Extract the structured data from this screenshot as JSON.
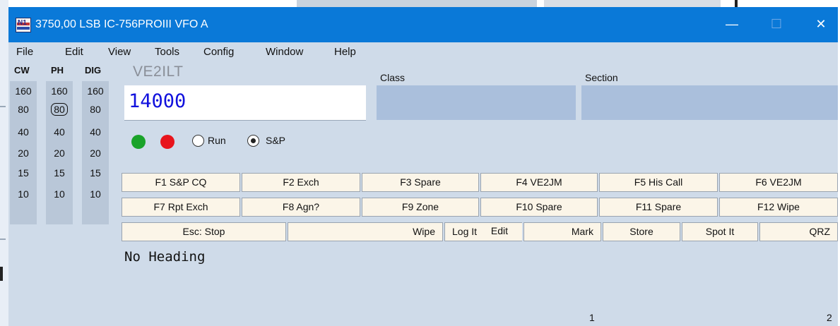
{
  "window": {
    "title": "3750,00 LSB IC-756PROIII VFO A"
  },
  "window_controls": {
    "minimize": "—",
    "maximize": "☐",
    "close": "✕"
  },
  "menu": [
    "File",
    "Edit",
    "View",
    "Tools",
    "Config",
    "Window",
    "Help"
  ],
  "bands": {
    "headers": [
      "CW",
      "PH",
      "DIG"
    ],
    "values": [
      "160",
      "80",
      "40",
      "20",
      "15",
      "10"
    ],
    "selected": {
      "column": "PH",
      "value": "80"
    }
  },
  "entry": {
    "callsign": "VE2ILT",
    "frequency": "14000",
    "class_label": "Class",
    "class_value": "",
    "section_label": "Section",
    "section_value": ""
  },
  "indicators": {
    "led1_color": "#1aa32a",
    "led2_color": "#e8141c"
  },
  "mode": {
    "options": [
      "Run",
      "S&P"
    ],
    "selected": "S&P"
  },
  "function_keys": {
    "row1": [
      "F1 S&P CQ",
      "F2 Exch",
      "F3 Spare",
      "F4 VE2JM",
      "F5 His Call",
      "F6 VE2JM"
    ],
    "row2": [
      "F7 Rpt Exch",
      "F8 Agn?",
      "F9 Zone",
      "F10 Spare",
      "F11 Spare",
      "F12 Wipe"
    ],
    "row3": [
      "Esc: Stop",
      "Wipe",
      "Log It",
      "Edit",
      "Mark",
      "Store",
      "Spot It",
      "QRZ"
    ]
  },
  "heading": "No Heading",
  "status": {
    "num1": "1",
    "num2": "2"
  }
}
